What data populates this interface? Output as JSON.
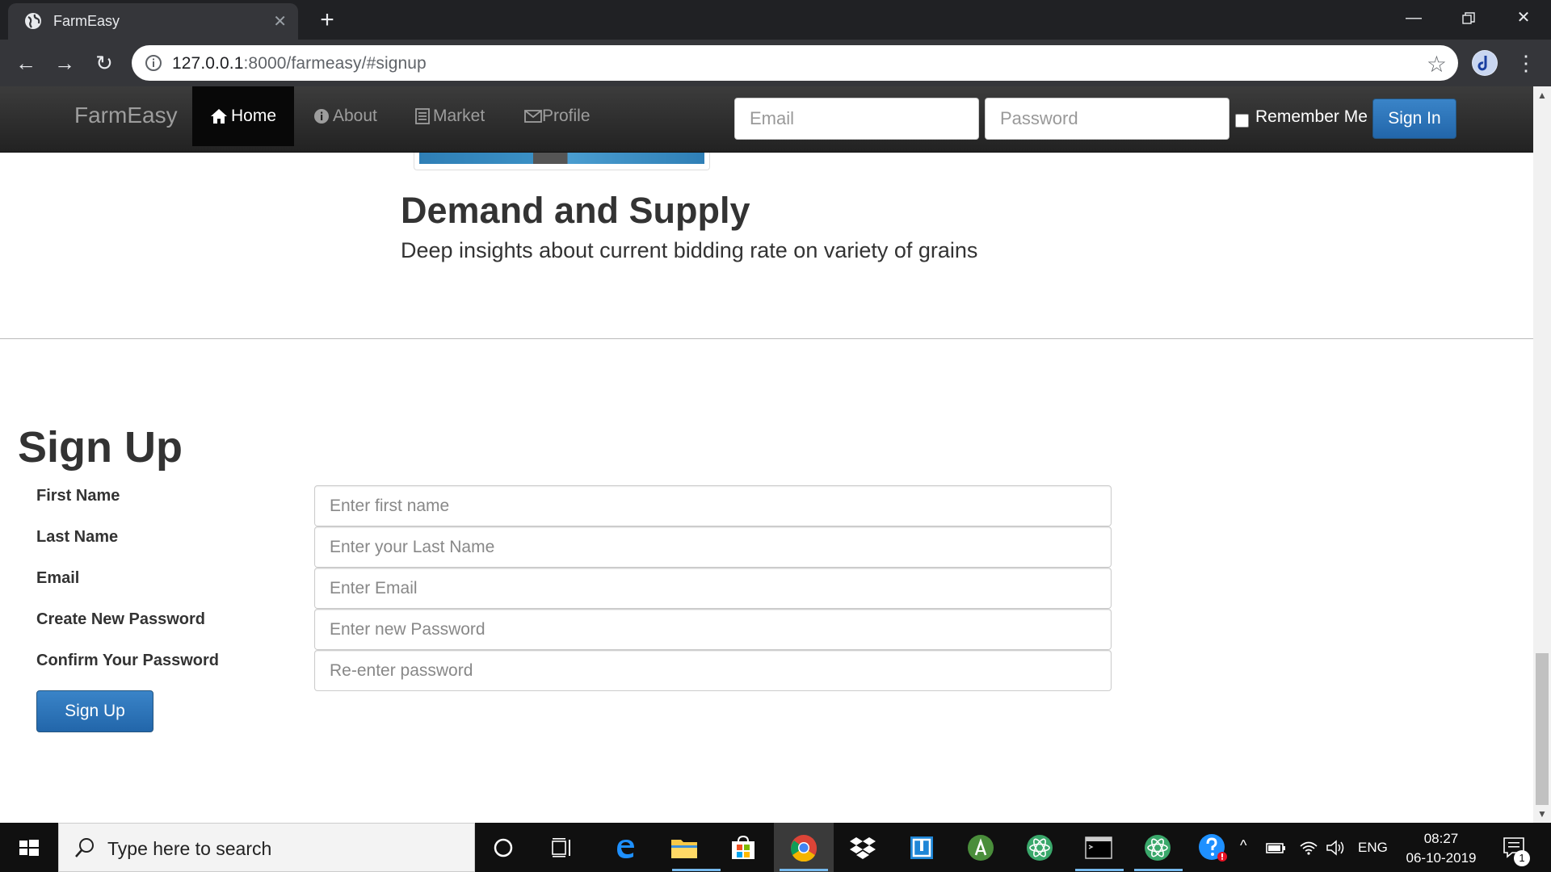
{
  "browser": {
    "tab_title": "FarmEasy",
    "url_host": "127.0.0.1",
    "url_rest": ":8000/farmeasy/#signup"
  },
  "navbar": {
    "brand": "FarmEasy",
    "links": [
      "Home",
      "About",
      "Market",
      "Profile"
    ],
    "email_placeholder": "Email",
    "password_placeholder": "Password",
    "remember_label": "Remember Me",
    "signin_label": "Sign In"
  },
  "feature": {
    "heading": "Demand and Supply",
    "text": "Deep insights about current bidding rate on variety of grains"
  },
  "signup": {
    "title": "Sign Up",
    "fields": [
      {
        "label": "First Name",
        "placeholder": "Enter first name"
      },
      {
        "label": "Last Name",
        "placeholder": "Enter your Last Name"
      },
      {
        "label": "Email",
        "placeholder": "Enter Email"
      },
      {
        "label": "Create New Password",
        "placeholder": "Enter new Password"
      },
      {
        "label": "Confirm Your Password",
        "placeholder": "Re-enter password"
      }
    ],
    "button_label": "Sign Up"
  },
  "taskbar": {
    "search_placeholder": "Type here to search",
    "language": "ENG",
    "time": "08:27",
    "date": "06-10-2019",
    "notification_count": "1"
  },
  "colors": {
    "navbar_bg": "#222222",
    "primary_button": "#2e6da4",
    "taskbar_bg": "#101010"
  }
}
